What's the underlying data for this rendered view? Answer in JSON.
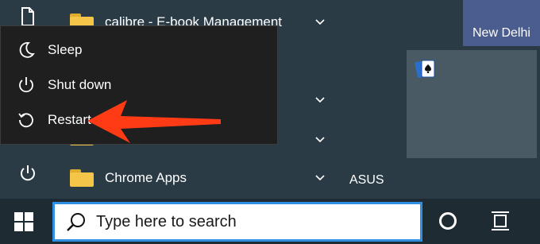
{
  "power_menu": {
    "items": [
      {
        "label": "Sleep",
        "icon": "moon-icon"
      },
      {
        "label": "Shut down",
        "icon": "power-icon"
      },
      {
        "label": "Restart",
        "icon": "restart-icon"
      }
    ]
  },
  "app_list": {
    "items": [
      {
        "label": "calibre - E-book Management",
        "icon": "folder-icon"
      },
      {
        "label": "",
        "icon": "folder-icon"
      },
      {
        "label": "Chrome Apps",
        "icon": "folder-icon"
      }
    ]
  },
  "tiles": {
    "weather_label": "New Delhi",
    "game_icon": "cards-icon",
    "group_label": "ASUS"
  },
  "taskbar": {
    "search_placeholder": "Type here to search"
  },
  "colors": {
    "accent": "#2f8fe2",
    "arrow": "#ff3b16",
    "folder": "#f5c54a",
    "start_bg": "#2b3b46"
  }
}
